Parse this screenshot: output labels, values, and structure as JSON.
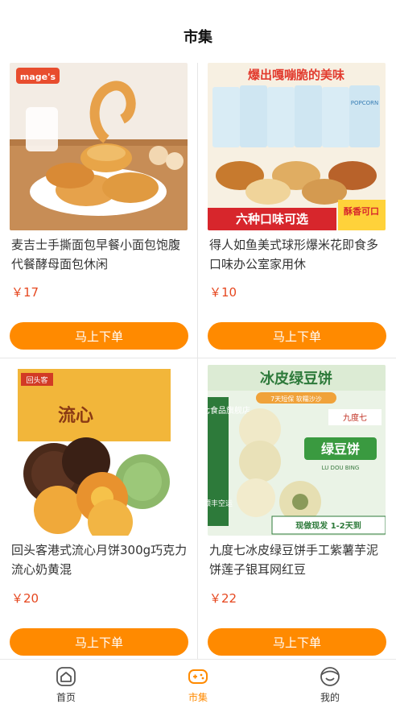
{
  "header": {
    "title": "市集"
  },
  "products": [
    {
      "title": "麦吉士手撕面包早餐小面包饱腹代餐酵母面包休闲",
      "price": "￥17",
      "button": "马上下单",
      "brand": "mage's"
    },
    {
      "title": "得人如鱼美式球形爆米花即食多口味办公室家用休",
      "price": "￥10",
      "button": "马上下单",
      "banner_top": "爆出嘎嘣脆的美味",
      "banner_bottom": "六种口味可选",
      "badge": "酥香可口",
      "bag_text": "POPCORN"
    },
    {
      "title": "回头客港式流心月饼300g巧克力流心奶黄混",
      "price": "￥20",
      "button": "马上下单",
      "brand": "回头客",
      "box_text": "流心"
    },
    {
      "title": "九度七冰皮绿豆饼手工紫薯芋泥饼莲子银耳网红豆",
      "price": "￥22",
      "button": "马上下单",
      "banner_top": "冰皮绿豆饼",
      "tag": "7天短保 软糯沙沙",
      "shop": "九度七食品旗舰店",
      "brand": "九度七",
      "side": "顺丰空运",
      "big": "绿豆饼",
      "sub": "LU DOU BING",
      "bottom": "现做现发 1-2天到"
    }
  ],
  "tabs": [
    {
      "label": "首页",
      "icon": "home-icon"
    },
    {
      "label": "市集",
      "icon": "gamepad-icon"
    },
    {
      "label": "我的",
      "icon": "profile-icon"
    }
  ],
  "colors": {
    "accent": "#ff8a00",
    "price": "#e6471f"
  }
}
